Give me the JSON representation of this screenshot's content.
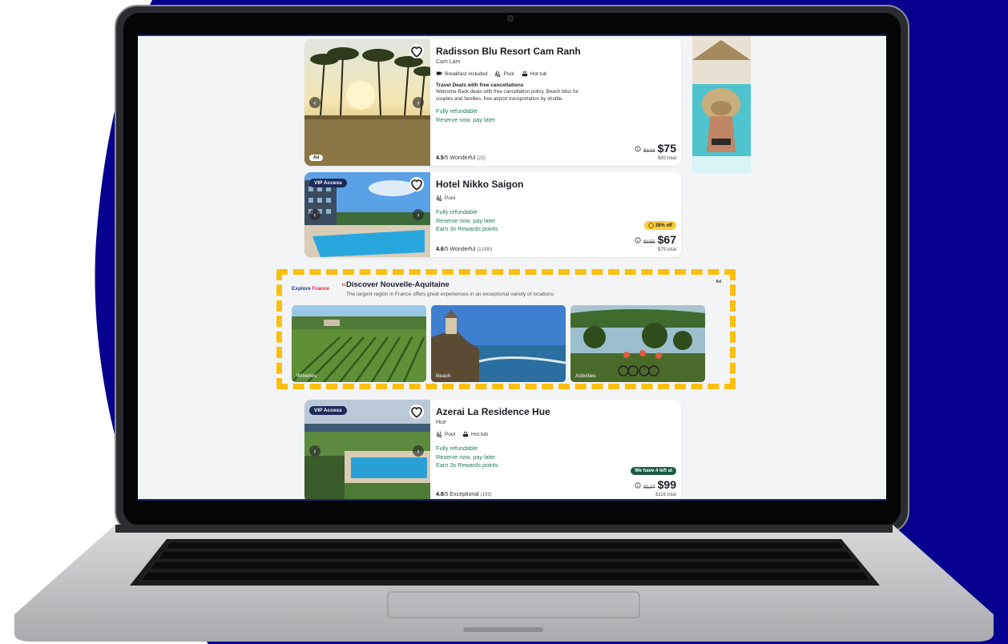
{
  "colors": {
    "background_blue": "#07008e",
    "highlight_yellow": "#fbbf0e",
    "refund_green": "#1f7a55",
    "vip_navy": "#1c2b5a"
  },
  "listings": [
    {
      "name": "Radisson Blu Resort Cam Ranh",
      "location": "Cam Lam",
      "amenities": [
        {
          "icon": "breakfast-icon",
          "label": "Breakfast included"
        },
        {
          "icon": "pool-icon",
          "label": "Pool"
        },
        {
          "icon": "hot-tub-icon",
          "label": "Hot tub"
        }
      ],
      "deal_title": "Travel Deals with free cancellations",
      "deal_text": "Welcome Back deals with free cancellation policy. Beach bliss for couples and families, free airport transportation by shuttle.",
      "perks": [
        "Fully refundable",
        "Reserve now, pay later"
      ],
      "rating_score": "4.5",
      "rating_text": "/5 Wonderful",
      "rating_count": "(22)",
      "old_price": "$103",
      "price": "$75",
      "total": "$89 total",
      "photo_badge": "Ad"
    },
    {
      "name": "Hotel Nikko Saigon",
      "location": "",
      "amenities": [
        {
          "icon": "pool-icon",
          "label": "Pool"
        }
      ],
      "perks": [
        "Fully refundable",
        "Reserve now, pay later",
        "Earn 3x Rewards points"
      ],
      "rating_score": "4.6",
      "rating_text": "/5 Wonderful",
      "rating_count": "(1,000)",
      "badge": "39% off",
      "old_price": "$155",
      "price": "$67",
      "total": "$79 total",
      "photo_badge": "VIP Access"
    },
    {
      "name": "Azerai La Residence Hue",
      "location": "Hue",
      "amenities": [
        {
          "icon": "pool-icon",
          "label": "Pool"
        },
        {
          "icon": "hot-tub-icon",
          "label": "Hot tub"
        }
      ],
      "perks": [
        "Fully refundable",
        "Reserve now, pay later",
        "Earn 3x Rewards points"
      ],
      "rating_score": "4.8",
      "rating_text": "/5 Exceptional",
      "rating_count": "(193)",
      "badge": "We have 4 left at",
      "old_price": "$127",
      "price": "$99",
      "total": "$116 total",
      "photo_badge": "VIP Access"
    }
  ],
  "promo": {
    "logo_part1": "Explore",
    "logo_part2": "France",
    "quote_mark": "”",
    "title": "Discover Nouvelle-Aquitaine",
    "subtitle": "The largest region in France offers great experiences in an exceptional variety of locations",
    "ad_label": "Ad",
    "tiles": [
      {
        "label": "Wineries"
      },
      {
        "label": "Beach"
      },
      {
        "label": "Activities"
      }
    ]
  }
}
